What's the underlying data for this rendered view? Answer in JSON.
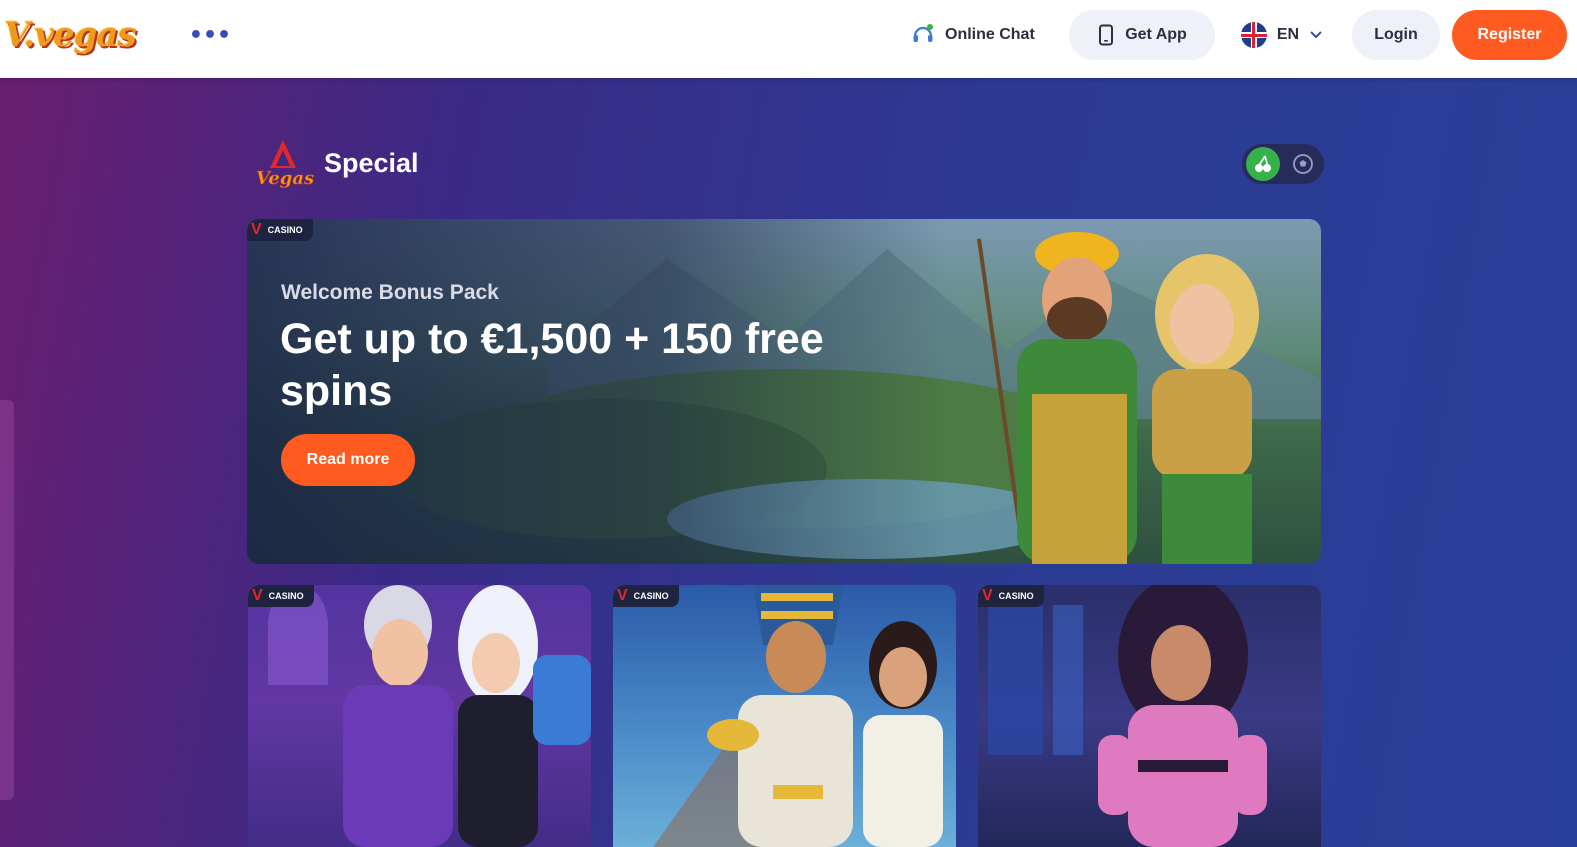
{
  "header": {
    "logo_text": "V.vegas",
    "more_icon": "ellipsis-icon",
    "online_chat_label": "Online Chat",
    "get_app_label": "Get App",
    "language_label": "EN",
    "login_label": "Login",
    "register_label": "Register"
  },
  "section": {
    "title": "Special",
    "toggle_options": [
      "casino-cherry-icon",
      "sports-ball-icon"
    ],
    "active_toggle": "casino-cherry-icon"
  },
  "hero": {
    "badge": "CASINO",
    "subtitle": "Welcome Bonus Pack",
    "title": "Get up to €1,500 + 150 free spins",
    "cta_label": "Read more"
  },
  "cards": [
    {
      "badge": "CASINO"
    },
    {
      "badge": "CASINO"
    },
    {
      "badge": "CASINO"
    }
  ],
  "colors": {
    "accent": "#ff5a1f",
    "active_toggle": "#37b24a",
    "header_bg": "#ffffff",
    "badge_v": "#e4262a"
  }
}
